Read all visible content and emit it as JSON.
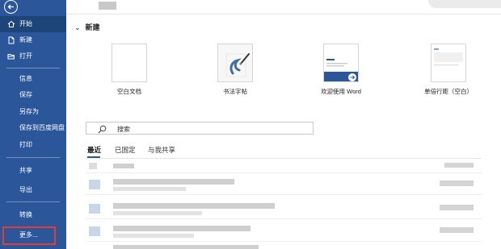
{
  "sidebar": {
    "items": [
      {
        "label": "开始",
        "icon": "home-icon"
      },
      {
        "label": "新建",
        "icon": "new-file-icon"
      },
      {
        "label": "打开",
        "icon": "folder-open-icon"
      },
      {
        "label": "信息"
      },
      {
        "label": "保存"
      },
      {
        "label": "另存为"
      },
      {
        "label": "保存到百度网盘"
      },
      {
        "label": "打印"
      },
      {
        "label": "共享"
      },
      {
        "label": "导出"
      },
      {
        "label": "转换"
      },
      {
        "label": "更多..."
      }
    ]
  },
  "main": {
    "section_title": "新建",
    "templates": [
      {
        "label": "空白文档"
      },
      {
        "label": "书法字帖"
      },
      {
        "label": "欢迎使用 Word"
      },
      {
        "label": "单倍行距（空白）"
      }
    ],
    "search": {
      "placeholder": "搜索"
    },
    "tabs": [
      {
        "label": "最近"
      },
      {
        "label": "已固定"
      },
      {
        "label": "与我共享"
      }
    ]
  },
  "colors": {
    "sidebar_bg": "#2b579a",
    "sidebar_active": "#1e4579",
    "highlight": "#e23b3b"
  }
}
